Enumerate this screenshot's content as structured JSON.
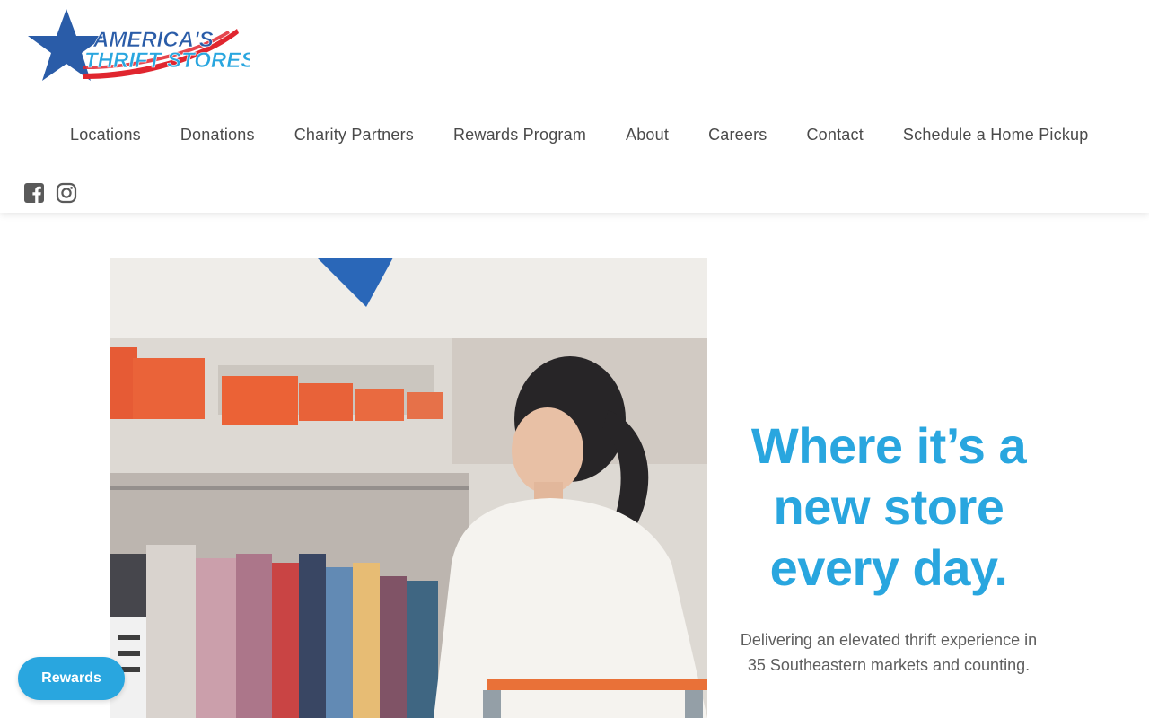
{
  "brand": {
    "logo_line1": "AMERICA'S",
    "logo_line2": "THRIFT STORES",
    "colors": {
      "blue": "#2a5ca8",
      "red": "#e0262f",
      "accent": "#29a6df"
    }
  },
  "nav": {
    "items": [
      {
        "label": "Locations"
      },
      {
        "label": "Donations"
      },
      {
        "label": "Charity Partners"
      },
      {
        "label": "Rewards Program"
      },
      {
        "label": "About"
      },
      {
        "label": "Careers"
      },
      {
        "label": "Contact"
      },
      {
        "label": "Schedule a Home Pickup"
      }
    ]
  },
  "social": {
    "icons": [
      "facebook-icon",
      "instagram-icon"
    ]
  },
  "hero": {
    "headline": "Where it’s a new store every day.",
    "subtext": "Delivering an elevated thrift experience in 35 Southeastern markets and counting."
  },
  "rewards_button": {
    "label": "Rewards"
  }
}
